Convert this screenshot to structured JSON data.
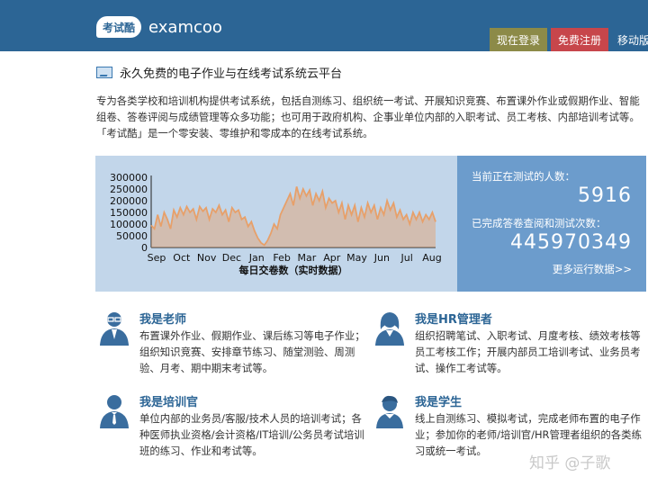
{
  "header": {
    "logo_mark": "考试酷",
    "brand": "examcoo",
    "login_label": "现在登录",
    "register_label": "免费注册",
    "mobile_label": "移动版"
  },
  "title": "永久免费的电子作业与在线考试系统云平台",
  "intro": "专为各类学校和培训机构提供考试系统，包括自测练习、组织统一考试、开展知识竞赛、布置课外作业或假期作业、智能组卷、答卷评阅与成绩管理等众多功能；也可用于政府机构、企事业单位内部的入职考试、员工考核、内部培训考试等。「考试酷」是一个零安装、零维护和零成本的在线考试系统。",
  "stats": {
    "testing_label": "当前正在测试的人数：",
    "testing_value": "5916",
    "completed_label": "已完成答卷查阅和测试次数：",
    "completed_value": "445970349",
    "more_link": "更多运行数据>>"
  },
  "chart_data": {
    "type": "area",
    "xlabel": "每日交卷数（实时数据）",
    "ylim": [
      0,
      300000
    ],
    "y_ticks": [
      "300000",
      "250000",
      "200000",
      "150000",
      "100000",
      "50000",
      "0"
    ],
    "x_ticks": [
      "Sep",
      "Oct",
      "Nov",
      "Dec",
      "Jan",
      "Feb",
      "Mar",
      "Apr",
      "May",
      "Jun",
      "Jul",
      "Aug"
    ],
    "color": "#e7a06a",
    "values": [
      95000,
      80000,
      140000,
      90000,
      150000,
      120000,
      80000,
      160000,
      130000,
      170000,
      140000,
      175000,
      150000,
      165000,
      120000,
      175000,
      155000,
      170000,
      120000,
      165000,
      150000,
      180000,
      140000,
      160000,
      110000,
      170000,
      150000,
      160000,
      120000,
      130000,
      90000,
      110000,
      70000,
      40000,
      20000,
      10000,
      30000,
      60000,
      100000,
      80000,
      140000,
      170000,
      200000,
      230000,
      180000,
      260000,
      210000,
      250000,
      220000,
      245000,
      180000,
      230000,
      200000,
      240000,
      170000,
      210000,
      190000,
      200000,
      150000,
      190000,
      120000,
      180000,
      140000,
      180000,
      110000,
      170000,
      130000,
      190000,
      150000,
      180000,
      120000,
      170000,
      140000,
      200000,
      160000,
      190000,
      130000,
      160000,
      120000,
      140000,
      100000,
      150000,
      120000,
      150000,
      110000,
      140000,
      120000,
      150000,
      110000
    ]
  },
  "roles": [
    {
      "title": "我是老师",
      "desc": "布置课外作业、假期作业、课后练习等电子作业；组织知识竞赛、安排章节练习、随堂测验、周测验、月考、期中期末考试等。"
    },
    {
      "title": "我是HR管理者",
      "desc": "组织招聘笔试、入职考试、月度考核、绩效考核等员工考核工作；开展内部员工培训考试、业务员考试、操作工考试等。"
    },
    {
      "title": "我是培训官",
      "desc": "单位内部的业务员/客服/技术人员的培训考试；各种医师执业资格/会计资格/IT培训/公务员考试培训班的练习、作业和考试等。"
    },
    {
      "title": "我是学生",
      "desc": "线上自测练习、模拟考试，完成老师布置的电子作业；参加你的老师/培训官/HR管理者组织的各类练习或统一考试。"
    }
  ],
  "watermark": "知乎 @子歌"
}
